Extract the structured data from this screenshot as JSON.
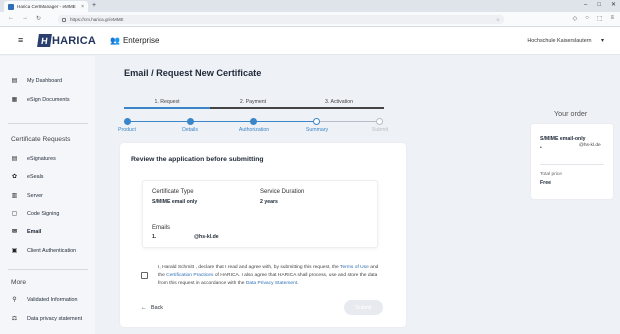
{
  "browser": {
    "tab_title": "Harica CertManager - eMME",
    "url": "https://cm.harica.gr/eMME",
    "new_tab": "+",
    "close_tab": "×"
  },
  "header": {
    "logo_mark": "H",
    "logo_text": "HARICA",
    "enterprise_label": "Enterprise",
    "org_name": "Hochschule Kaiserslautern"
  },
  "sidebar": {
    "items_top": [
      {
        "label": "My Dashboard",
        "icon": "dashboard-icon"
      },
      {
        "label": "eSign Documents",
        "icon": "document-icon"
      }
    ],
    "section_certificate_requests": "Certificate Requests",
    "items_cert": [
      {
        "label": "eSignatures",
        "icon": "signature-icon"
      },
      {
        "label": "eSeals",
        "icon": "seal-icon"
      },
      {
        "label": "Server",
        "icon": "server-icon"
      },
      {
        "label": "Code Signing",
        "icon": "code-icon"
      },
      {
        "label": "Email",
        "icon": "email-icon"
      },
      {
        "label": "Client Authentication",
        "icon": "client-auth-icon"
      }
    ],
    "section_more": "More",
    "items_more": [
      {
        "label": "Validated Information",
        "icon": "validated-icon"
      },
      {
        "label": "Data privacy statement",
        "icon": "privacy-icon"
      }
    ]
  },
  "main": {
    "title": "Email / Request New Certificate",
    "steps_top": [
      "1. Request",
      "2. Payment",
      "3. Activation"
    ],
    "progress_steps": [
      {
        "label": "Product",
        "state": "done"
      },
      {
        "label": "Details",
        "state": "done"
      },
      {
        "label": "Authorization",
        "state": "done"
      },
      {
        "label": "Summary",
        "state": "current"
      },
      {
        "label": "Submit",
        "state": "pending"
      }
    ],
    "review_title": "Review the application before submitting",
    "certificate_type_label": "Certificate Type",
    "certificate_type_value": "S/MIME email only",
    "service_duration_label": "Service Duration",
    "service_duration_value": "2 years",
    "emails_label": "Emails",
    "email_index": "1.",
    "email_value": "@hs-kl.de",
    "decl_1": "I, Harald Schmitt , declare that I read and agree with, by submitting this request, the ",
    "decl_link_terms": "Terms of Use",
    "decl_2": " and the ",
    "decl_link_practices": "Certification Practices",
    "decl_3": " of HARICA. I also agree that HARICA shall process, use and store the data from this request in accordance with the ",
    "decl_link_privacy": "Data Privacy Statement",
    "decl_4": ".",
    "back_label": "Back",
    "submit_label": "Submit"
  },
  "order": {
    "title": "Your order",
    "product": "S/MIME email-only",
    "bullet": "•",
    "email": "@hs-kl.de",
    "total_label": "Total price",
    "total_value": "Free"
  },
  "colors": {
    "accent": "#3a86c8",
    "brand": "#23345e",
    "link": "#2f6fb4"
  }
}
